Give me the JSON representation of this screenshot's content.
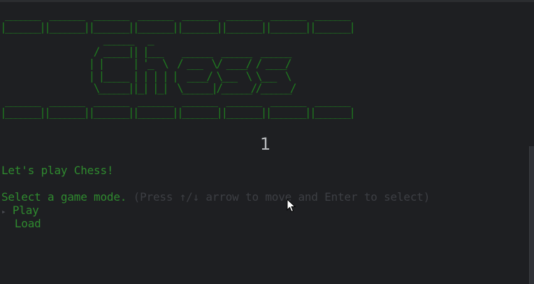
{
  "banner": {
    "ascii_art": " _______  _______  _______  _______  _______  _______  _______  _______\n|_______||_______||_______||_______||_______||_______||_______||_______|\n                     ______   _\n                   / _____|| |___    ______  ______  ______\n                  | |      | '_  \\  / ___  \\/ ____/ / ____/\n                  | |_____ | | | | |  ____/ \\___  \\ \\___  \\\n                   \\______||_| |_|  \\______|/______//______/\n _______  _______  _______  _______  _______  _______  _______  _______\n|_______||_______||_______||_______||_______||_______||_______||_______|"
  },
  "counter": "1",
  "greeting": "Let's play Chess!",
  "prompt": {
    "label": "Select a game mode.",
    "hint": "(Press ↑/↓ arrow to move and Enter to select)"
  },
  "menu": {
    "marker": "▸",
    "options": [
      "Play",
      "Load"
    ],
    "selected": "Play"
  },
  "colors": {
    "background": "#1e1f22",
    "accent_green": "#2f8a2f",
    "hint_gray": "#3d3f44"
  }
}
